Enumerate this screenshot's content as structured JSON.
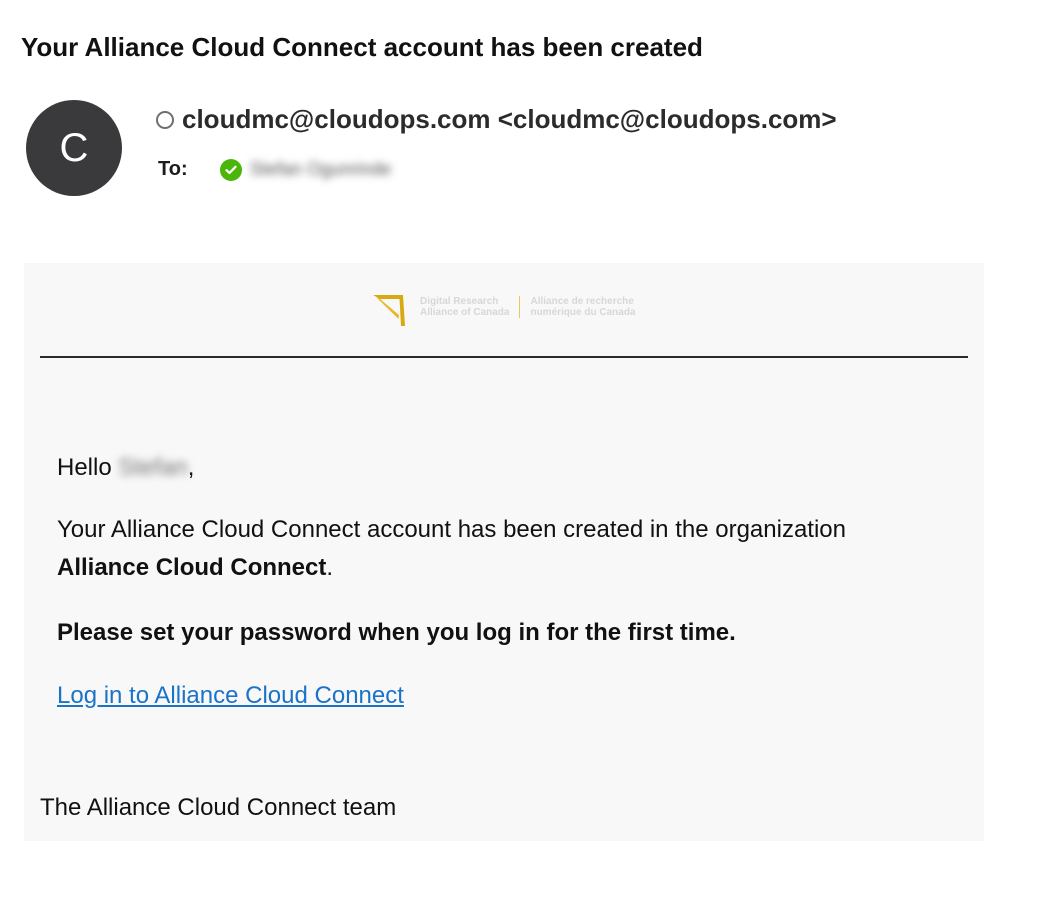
{
  "email": {
    "subject": "Your Alliance Cloud Connect account has been created",
    "sender": {
      "avatar_initial": "C",
      "display": "cloudmc@cloudops.com <cloudmc@cloudops.com>"
    },
    "to": {
      "label": "To:",
      "recipient": "Stefan Ogunrinde"
    }
  },
  "logo": {
    "en_line1": "Digital Research",
    "en_line2": "Alliance of Canada",
    "fr_line1": "Alliance de recherche",
    "fr_line2": "numérique du Canada"
  },
  "message": {
    "greeting_prefix": "Hello",
    "greeting_name": "Stefan",
    "greeting_suffix": ",",
    "para1_prefix": "Your Alliance Cloud Connect account has been created in the organization",
    "para1_org": "Alliance Cloud Connect",
    "para1_suffix": ".",
    "password_note": "Please set your password when you log in for the first time.",
    "login_link": "Log in to Alliance Cloud Connect",
    "signoff": "The Alliance Cloud Connect team"
  },
  "colors": {
    "link": "#1a73c8",
    "verified": "#4cb50a",
    "logo_accent": "#d9a914",
    "avatar_bg": "#3a3a3c"
  }
}
